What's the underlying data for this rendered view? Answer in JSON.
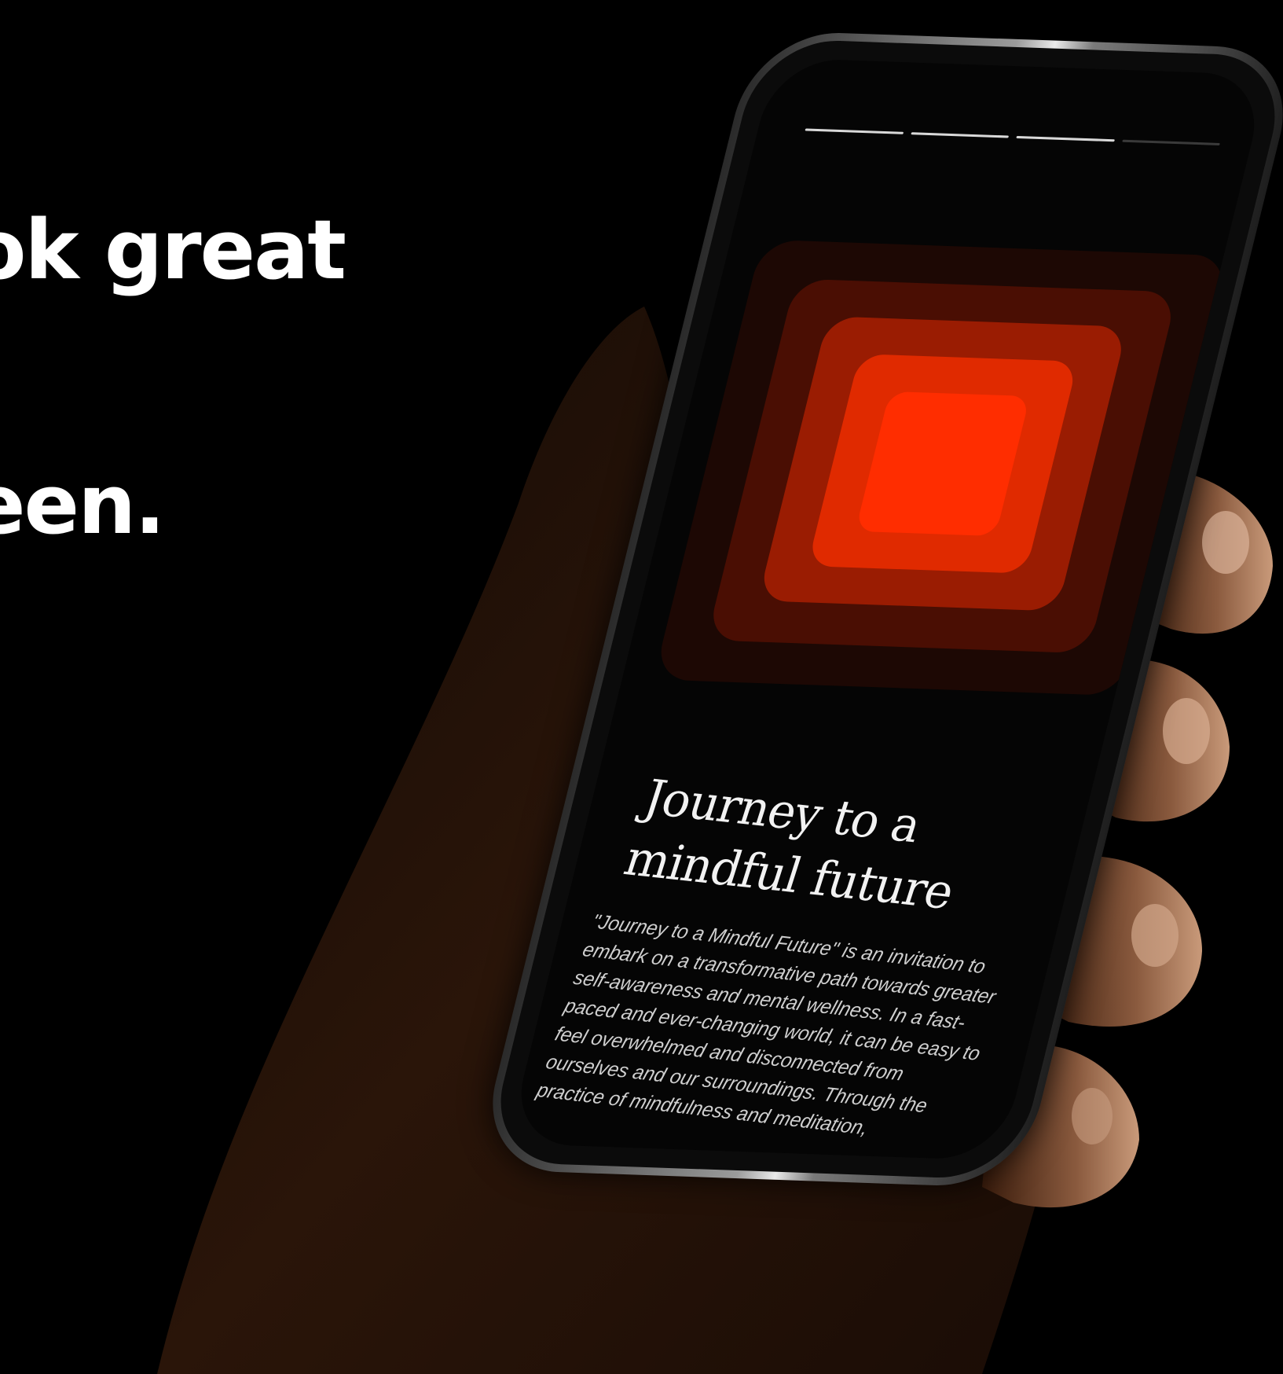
{
  "headline": {
    "line1": "ok great",
    "line2": "een."
  },
  "phone": {
    "progress": {
      "segments": 4,
      "active_segments": 3
    },
    "artwork": {
      "colors": [
        "#1d0804",
        "#4a0e03",
        "#9a1c02",
        "#e02a00",
        "#ff2d00"
      ]
    },
    "title_line1": "Journey to a",
    "title_line2": "mindful future",
    "body": "\"Journey to a Mindful Future\" is an invitation to embark on a transformative path towards greater self-awareness and mental wellness. In a fast-paced and ever-changing world, it can be easy to feel overwhelmed and disconnected from ourselves and our surroundings. Through the practice of mindfulness and meditation,"
  },
  "colors": {
    "background": "#000000",
    "accent": "#ff2d00",
    "text": "#ffffff"
  }
}
